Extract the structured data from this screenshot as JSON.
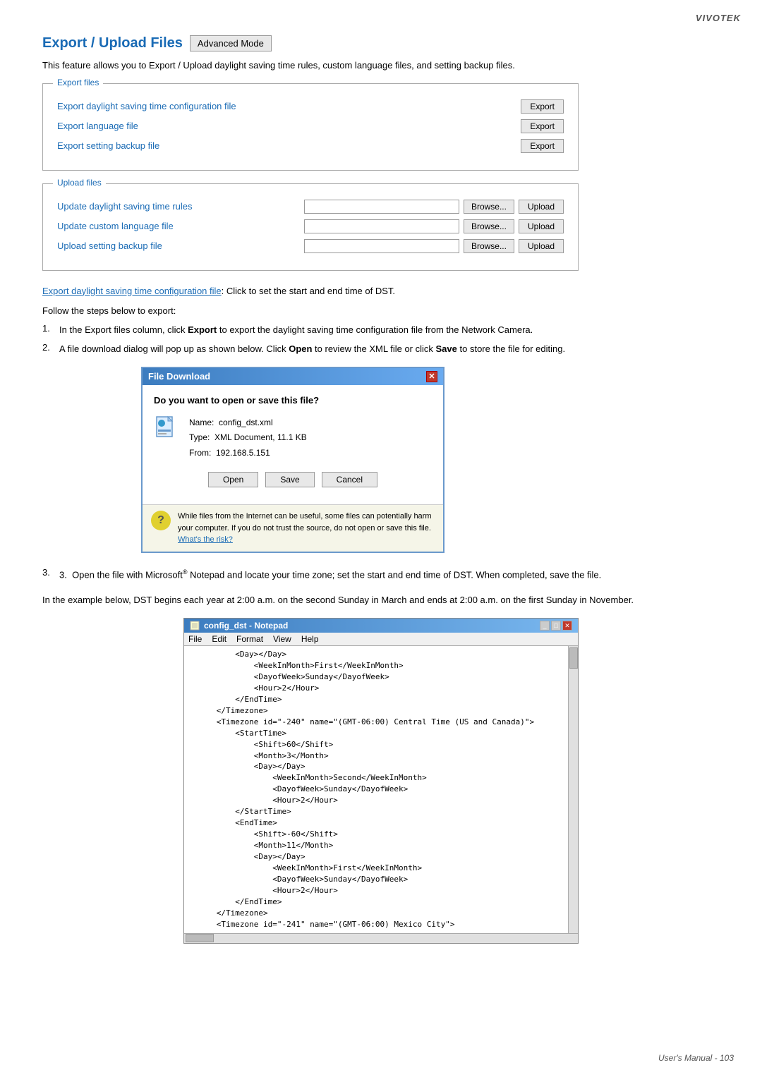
{
  "brand": "VIVOTEK",
  "page": {
    "title": "Export / Upload Files",
    "advanced_mode_btn": "Advanced Mode",
    "intro": "This feature allows you to Export / Upload daylight saving time rules, custom language files, and setting backup files.",
    "export_section": {
      "legend": "Export files",
      "rows": [
        {
          "label": "Export daylight saving time configuration file",
          "btn": "Export"
        },
        {
          "label": "Export language file",
          "btn": "Export"
        },
        {
          "label": "Export setting backup file",
          "btn": "Export"
        }
      ]
    },
    "upload_section": {
      "legend": "Upload files",
      "rows": [
        {
          "label": "Update daylight saving time rules",
          "browse_btn": "Browse...",
          "upload_btn": "Upload"
        },
        {
          "label": "Update custom language file",
          "browse_btn": "Browse...",
          "upload_btn": "Upload"
        },
        {
          "label": "Upload setting backup file",
          "browse_btn": "Browse...",
          "upload_btn": "Upload"
        }
      ]
    },
    "link_label": "Export daylight saving time configuration file",
    "link_desc": ": Click to set the start and end time of DST.",
    "steps_intro": "Follow the steps below to export:",
    "steps": [
      {
        "num": "1.",
        "text": "In the Export files column, click Export to export the daylight saving time configuration file from the Network Camera."
      },
      {
        "num": "2.",
        "text": "A file download dialog will pop up as shown below. Click Open to review the XML file or click Save to store the file for editing."
      }
    ],
    "step3_pre": "3.  Open the file with Microsoft",
    "step3_sup": "®",
    "step3_post": " Notepad and locate your time zone; set the start and end time of DST. When completed, save the file.",
    "dst_example": "In the example below, DST begins each year at 2:00 a.m. on the second Sunday in March and ends at 2:00 a.m. on the first Sunday in November."
  },
  "file_download_dialog": {
    "title": "File Download",
    "question": "Do you want to open or save this file?",
    "file_name_label": "Name:",
    "file_name_value": "config_dst.xml",
    "file_type_label": "Type:",
    "file_type_value": "XML Document, 11.1 KB",
    "file_from_label": "From:",
    "file_from_value": "192.168.5.151",
    "open_btn": "Open",
    "save_btn": "Save",
    "cancel_btn": "Cancel",
    "warning_text": "While files from the Internet can be useful, some files can potentially harm your computer. If you do not trust the source, do not open or save this file.",
    "warning_link": "What's the risk?"
  },
  "notepad": {
    "title": "config_dst - Notepad",
    "menu_items": [
      "File",
      "Edit",
      "Format",
      "View",
      "Help"
    ],
    "code": "          <Day></Day>\n              <WeekInMonth>First</WeekInMonth>\n              <DayofWeek>Sunday</DayofWeek>\n              <Hour>2</Hour>\n          </EndTime>\n      </Timezone>\n      <Timezone id=\"-240\" name=\"(GMT-06:00) Central Time (US and Canada)\">\n          <StartTime>\n              <Shift>60</Shift>\n              <Month>3</Month>\n              <Day></Day>\n                  <WeekInMonth>Second</WeekInMonth>\n                  <DayofWeek>Sunday</DayofWeek>\n                  <Hour>2</Hour>\n          </StartTime>\n          <EndTime>\n              <Shift>-60</Shift>\n              <Month>11</Month>\n              <Day></Day>\n                  <WeekInMonth>First</WeekInMonth>\n                  <DayofWeek>Sunday</DayofWeek>\n                  <Hour>2</Hour>\n          </EndTime>\n      </Timezone>\n      <Timezone id=\"-241\" name=\"(GMT-06:00) Mexico City\">"
  },
  "footer": {
    "page_label": "User's Manual - 103"
  }
}
